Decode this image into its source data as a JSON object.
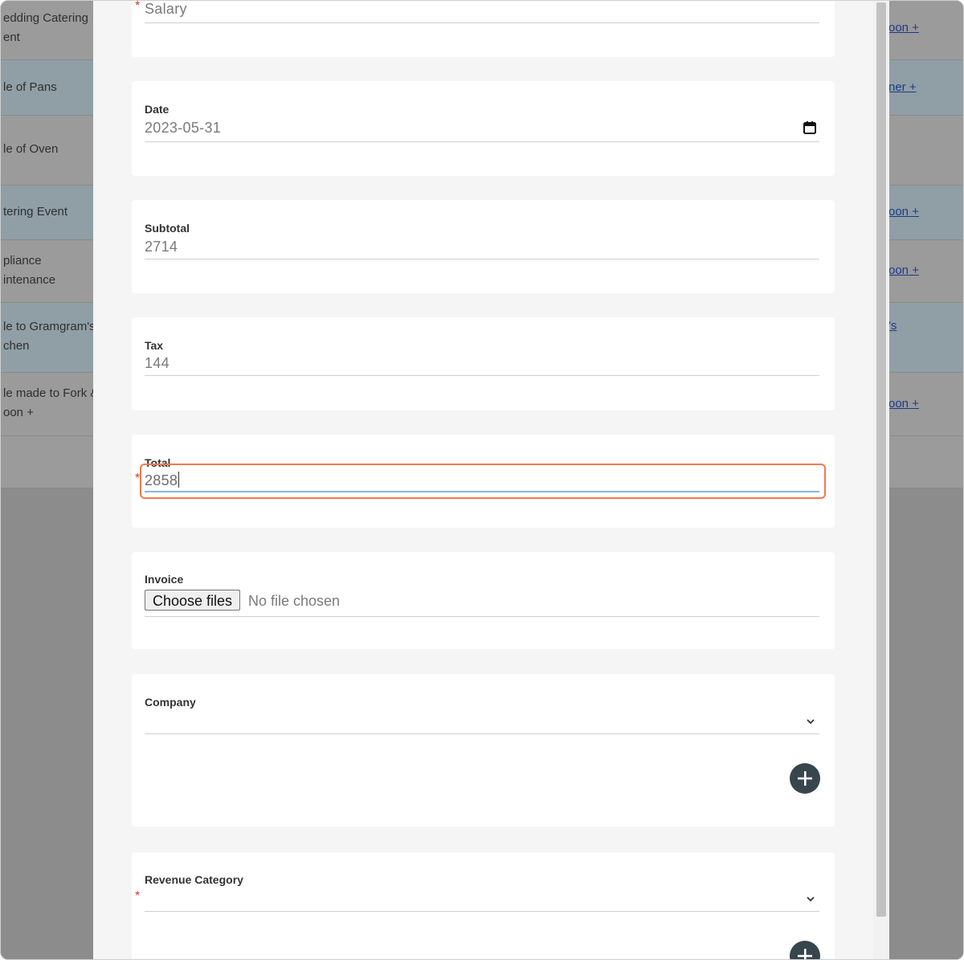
{
  "background_rows": [
    {
      "left": "edding Catering\nent",
      "right": "oon +"
    },
    {
      "left": "le of Pans",
      "right": "ner +"
    },
    {
      "left": "le of Oven",
      "right": ""
    },
    {
      "left": "tering Event",
      "right": "oon +"
    },
    {
      "left": "pliance\nintenance",
      "right": "oon +"
    },
    {
      "left": "le to Gramgram's\nchen",
      "right": "'s"
    },
    {
      "left": "le made to Fork &\noon +",
      "right": "oon +"
    },
    {
      "left": "",
      "right": ""
    }
  ],
  "form": {
    "salary": {
      "value": "Salary",
      "required_mark": "*"
    },
    "date": {
      "label": "Date",
      "value": "2023-05-31"
    },
    "subtotal": {
      "label": "Subtotal",
      "value": "2714"
    },
    "tax": {
      "label": "Tax",
      "value": "144"
    },
    "total": {
      "label": "Total",
      "value": "2858",
      "required_mark": "*"
    },
    "invoice": {
      "label": "Invoice",
      "button_label": "Choose files",
      "status": "No file chosen"
    },
    "company": {
      "label": "Company",
      "value": ""
    },
    "revenue_category": {
      "label": "Revenue Category",
      "value": "",
      "required_mark": "*"
    }
  },
  "icons": {
    "calendar": "calendar-icon",
    "chevron": "chevron-down-icon",
    "add": "plus-icon"
  },
  "colors": {
    "focus_ring": "#ef7b4f",
    "focus_underline": "#7fb9e6",
    "required": "#d43a2f",
    "add_button": "#37454d",
    "link": "#1d3a8a"
  }
}
